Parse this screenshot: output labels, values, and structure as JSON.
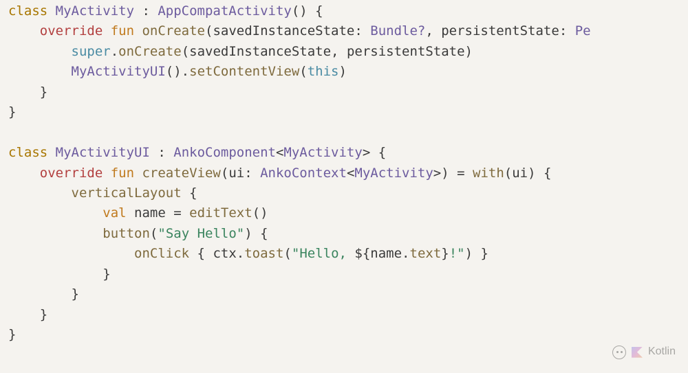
{
  "watermark": {
    "label": "Kotlin"
  },
  "code": {
    "tokens": [
      {
        "t": "class ",
        "c": "kw-class"
      },
      {
        "t": "MyActivity",
        "c": "type"
      },
      {
        "t": " : "
      },
      {
        "t": "AppCompatActivity",
        "c": "type"
      },
      {
        "t": "() {"
      },
      {
        "nl": 1
      },
      {
        "t": "    "
      },
      {
        "t": "override ",
        "c": "kw-override"
      },
      {
        "t": "fun ",
        "c": "kw-fun"
      },
      {
        "t": "onCreate",
        "c": "fn-name"
      },
      {
        "t": "("
      },
      {
        "t": "savedInstanceState",
        "c": "param"
      },
      {
        "t": ": "
      },
      {
        "t": "Bundle?",
        "c": "type"
      },
      {
        "t": ", "
      },
      {
        "t": "persistentState",
        "c": "param"
      },
      {
        "t": ": "
      },
      {
        "t": "Pe",
        "c": "type"
      },
      {
        "nl": 1
      },
      {
        "t": "        "
      },
      {
        "t": "super",
        "c": "kw-super-this"
      },
      {
        "t": "."
      },
      {
        "t": "onCreate",
        "c": "fn-call"
      },
      {
        "t": "("
      },
      {
        "t": "savedInstanceState"
      },
      {
        "t": ", "
      },
      {
        "t": "persistentState"
      },
      {
        "t": ")"
      },
      {
        "nl": 1
      },
      {
        "t": "        "
      },
      {
        "t": "MyActivityUI",
        "c": "type"
      },
      {
        "t": "()."
      },
      {
        "t": "setContentView",
        "c": "fn-call"
      },
      {
        "t": "("
      },
      {
        "t": "this",
        "c": "kw-super-this"
      },
      {
        "t": ")"
      },
      {
        "nl": 1
      },
      {
        "t": "    }"
      },
      {
        "nl": 1
      },
      {
        "t": "}"
      },
      {
        "nl": 1
      },
      {
        "nl": 1
      },
      {
        "t": "class ",
        "c": "kw-class"
      },
      {
        "t": "MyActivityUI",
        "c": "type"
      },
      {
        "t": " : "
      },
      {
        "t": "AnkoComponent",
        "c": "type"
      },
      {
        "t": "<"
      },
      {
        "t": "MyActivity",
        "c": "type"
      },
      {
        "t": "> {"
      },
      {
        "nl": 1
      },
      {
        "t": "    "
      },
      {
        "t": "override ",
        "c": "kw-override"
      },
      {
        "t": "fun ",
        "c": "kw-fun"
      },
      {
        "t": "createView",
        "c": "fn-name"
      },
      {
        "t": "("
      },
      {
        "t": "ui",
        "c": "param"
      },
      {
        "t": ": "
      },
      {
        "t": "AnkoContext",
        "c": "type"
      },
      {
        "t": "<"
      },
      {
        "t": "MyActivity",
        "c": "type"
      },
      {
        "t": ">) = "
      },
      {
        "t": "with",
        "c": "fn-call"
      },
      {
        "t": "("
      },
      {
        "t": "ui"
      },
      {
        "t": ") {"
      },
      {
        "nl": 1
      },
      {
        "t": "        "
      },
      {
        "t": "verticalLayout",
        "c": "fn-call"
      },
      {
        "t": " {"
      },
      {
        "nl": 1
      },
      {
        "t": "            "
      },
      {
        "t": "val ",
        "c": "kw-val"
      },
      {
        "t": "name"
      },
      {
        "t": " = "
      },
      {
        "t": "editText",
        "c": "fn-call"
      },
      {
        "t": "()"
      },
      {
        "nl": 1
      },
      {
        "t": "            "
      },
      {
        "t": "button",
        "c": "fn-call"
      },
      {
        "t": "("
      },
      {
        "t": "\"Say Hello\"",
        "c": "str"
      },
      {
        "t": ") {"
      },
      {
        "nl": 1
      },
      {
        "t": "                "
      },
      {
        "t": "onClick",
        "c": "fn-call"
      },
      {
        "t": " { "
      },
      {
        "t": "ctx"
      },
      {
        "t": "."
      },
      {
        "t": "toast",
        "c": "fn-call"
      },
      {
        "t": "("
      },
      {
        "t": "\"Hello, ",
        "c": "str"
      },
      {
        "t": "${",
        "c": "op"
      },
      {
        "t": "name"
      },
      {
        "t": "."
      },
      {
        "t": "text",
        "c": "fn-call"
      },
      {
        "t": "}",
        "c": "op"
      },
      {
        "t": "!\"",
        "c": "str"
      },
      {
        "t": ") }"
      },
      {
        "nl": 1
      },
      {
        "t": "            }"
      },
      {
        "nl": 1
      },
      {
        "t": "        }"
      },
      {
        "nl": 1
      },
      {
        "t": "    }"
      },
      {
        "nl": 1
      },
      {
        "t": "}"
      }
    ]
  }
}
